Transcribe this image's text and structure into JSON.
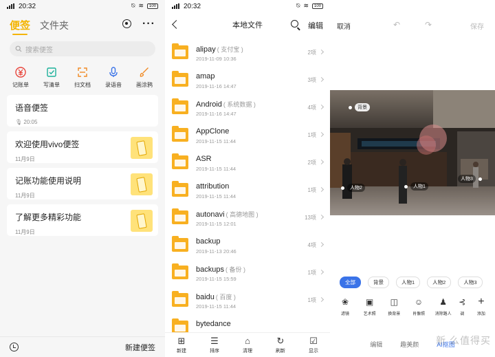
{
  "status_bar": {
    "time": "20:32",
    "signal": "4G",
    "battery": "100"
  },
  "notes_app": {
    "tab_active": "便签",
    "tab_inactive": "文件夹",
    "search_placeholder": "搜索便签",
    "quick_actions": [
      {
        "label": "记账单",
        "icon": "yuan-icon",
        "color": "#e8453c"
      },
      {
        "label": "写清单",
        "icon": "checklist-icon",
        "color": "#1cb09a"
      },
      {
        "label": "扫文档",
        "icon": "scan-icon",
        "color": "#f08a24"
      },
      {
        "label": "录语音",
        "icon": "microphone-icon",
        "color": "#3a73e8"
      },
      {
        "label": "画涂鸦",
        "icon": "brush-icon",
        "color": "#f08a24"
      }
    ],
    "notes": [
      {
        "title": "语音便签",
        "meta": "20:05",
        "has_thumb": false
      },
      {
        "title": "欢迎使用vivo便签",
        "meta": "11月9日",
        "has_thumb": true
      },
      {
        "title": "记账功能使用说明",
        "meta": "11月9日",
        "has_thumb": true
      },
      {
        "title": "了解更多精彩功能",
        "meta": "11月9日",
        "has_thumb": true
      }
    ],
    "new_note_label": "新建便签"
  },
  "file_manager": {
    "title": "本地文件",
    "edit_label": "编辑",
    "folders": [
      {
        "name": "alipay",
        "alias": "( 支付宝 )",
        "date": "2019-11-09 10:36",
        "count": "2项"
      },
      {
        "name": "amap",
        "alias": "",
        "date": "2019-11-16 14:47",
        "count": "3项"
      },
      {
        "name": "Android",
        "alias": "( 系统数据 )",
        "date": "2019-11-16 14:47",
        "count": "4项"
      },
      {
        "name": "AppClone",
        "alias": "",
        "date": "2019-11-15 11:44",
        "count": "1项"
      },
      {
        "name": "ASR",
        "alias": "",
        "date": "2019-11-15 11:44",
        "count": "2项"
      },
      {
        "name": "attribution",
        "alias": "",
        "date": "2019-11-15 11:44",
        "count": "1项"
      },
      {
        "name": "autonavi",
        "alias": "( 高德地图 )",
        "date": "2019-11-15 12:01",
        "count": "13项"
      },
      {
        "name": "backup",
        "alias": "",
        "date": "2019-11-13 20:46",
        "count": "4项"
      },
      {
        "name": "backups",
        "alias": "( 备份 )",
        "date": "2019-11-15 15:59",
        "count": "1项"
      },
      {
        "name": "baidu",
        "alias": "( 百度 )",
        "date": "2019-11-15 11:44",
        "count": "1项"
      },
      {
        "name": "bytedance",
        "alias": "",
        "date": "",
        "count": ""
      }
    ],
    "bottom_actions": [
      {
        "label": "新建",
        "icon": "new-folder-icon",
        "glyph": "⊞"
      },
      {
        "label": "排序",
        "icon": "sort-icon",
        "glyph": "☰"
      },
      {
        "label": "清理",
        "icon": "clean-icon",
        "glyph": "⌂"
      },
      {
        "label": "刷新",
        "icon": "refresh-icon",
        "glyph": "↻"
      },
      {
        "label": "显示",
        "icon": "display-icon",
        "glyph": "☑"
      }
    ]
  },
  "photo_editor": {
    "cancel_label": "取消",
    "save_label": "保存",
    "photo_tags": [
      "背景",
      "人物2",
      "人物1",
      "人物3"
    ],
    "filter_pills": [
      {
        "label": "全部",
        "active": true
      },
      {
        "label": "背景",
        "active": false
      },
      {
        "label": "人物1",
        "active": false
      },
      {
        "label": "人物2",
        "active": false
      },
      {
        "label": "人物3",
        "active": false
      }
    ],
    "tools": [
      {
        "label": "滤镜",
        "icon": "filter-icon",
        "glyph": "❀"
      },
      {
        "label": "艺术照",
        "icon": "art-photo-icon",
        "glyph": "▣"
      },
      {
        "label": "换背景",
        "icon": "replace-background-icon",
        "glyph": "◫"
      },
      {
        "label": "肖像照",
        "icon": "portrait-icon",
        "glyph": "☺"
      },
      {
        "label": "消除路人",
        "icon": "remove-passerby-icon",
        "glyph": "♟"
      },
      {
        "label": "调",
        "icon": "adjust-icon",
        "glyph": "⊰"
      },
      {
        "label": "添加",
        "icon": "add-icon",
        "glyph": "+"
      }
    ],
    "bottom_tabs": [
      {
        "label": "编辑",
        "active": false
      },
      {
        "label": "趣美颜",
        "active": false
      },
      {
        "label": "AI抠图",
        "active": true
      }
    ],
    "watermark": "新 么值得买"
  }
}
